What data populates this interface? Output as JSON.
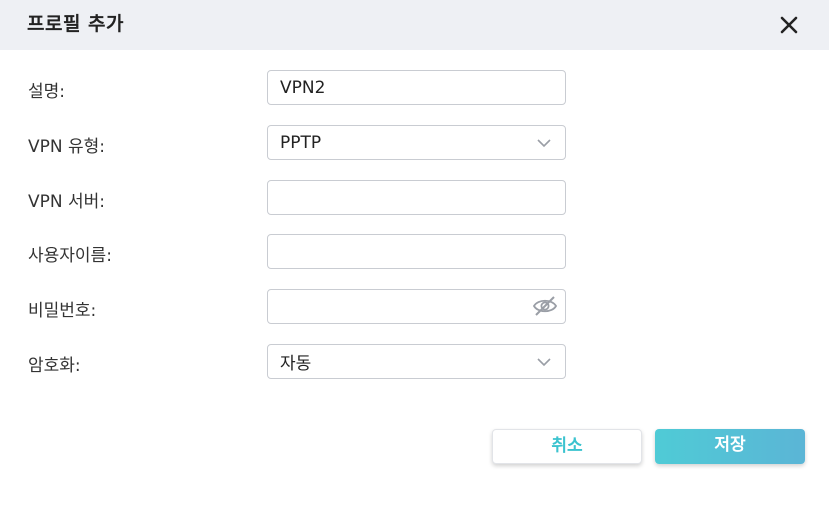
{
  "dialog": {
    "title": "프로필 추가",
    "close_icon": "close-icon"
  },
  "form": {
    "description": {
      "label": "설명:",
      "value": "VPN2"
    },
    "vpn_type": {
      "label": "VPN 유형:",
      "value": "PPTP",
      "icon": "chevron-down-icon"
    },
    "vpn_server": {
      "label": "VPN 서버:",
      "value": ""
    },
    "username": {
      "label": "사용자이름:",
      "value": ""
    },
    "password": {
      "label": "비밀번호:",
      "value": "",
      "icon": "eye-off-icon"
    },
    "encryption": {
      "label": "암호화:",
      "value": "자동",
      "icon": "chevron-down-icon"
    }
  },
  "buttons": {
    "cancel_label": "취소",
    "save_label": "저장"
  },
  "colors": {
    "header_bg": "#eef0f4",
    "accent": "#4fcbd6",
    "cancel_text": "#3bc3cf"
  }
}
